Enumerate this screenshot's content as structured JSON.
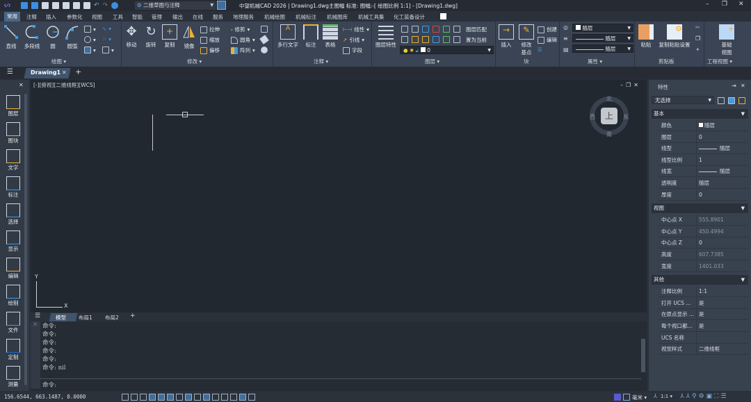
{
  "title": {
    "text": "中望机械CAD 2026 | Drawing1.dwg主图幅  标准: 图幅:-[ 绘图比例 1:1] - [Drawing1.dwg]",
    "workspace": "二维草图与注释"
  },
  "menu": [
    "常用",
    "注释",
    "插入",
    "参数化",
    "视图",
    "工具",
    "智能",
    "管理",
    "输出",
    "在线",
    "服务",
    "地理服务",
    "机械绘图",
    "机械标注",
    "机械图库",
    "机械工具集",
    "化工装备设计"
  ],
  "ribbon": {
    "draw": {
      "label": "绘图",
      "line": "直线",
      "polyline": "多段线",
      "circle": "圆",
      "arc": "圆弧"
    },
    "modify": {
      "label": "修改",
      "move": "移动",
      "rotate": "旋转",
      "copy": "复制",
      "mirror": "镜像",
      "stretch": "拉伸",
      "scale": "缩放",
      "offset": "偏移",
      "trim": "修剪",
      "fillet": "圆角",
      "array": "阵列"
    },
    "annotate": {
      "label": "注释",
      "mtext": "多行文字",
      "dim": "标注",
      "table": "表格",
      "linear": "线性",
      "leader": "引线",
      "field": "字段"
    },
    "layer": {
      "label": "图层",
      "props": "图层特性",
      "match": "图层匹配",
      "setcurrent": "置为当前",
      "current": "0"
    },
    "block": {
      "label": "块",
      "insert": "插入",
      "basepoint": "修改基点",
      "create": "创建",
      "edit": "编辑"
    },
    "properties": {
      "label": "属性",
      "color": "随层",
      "linetype": "随层",
      "lineweight": "随层"
    },
    "clipboard": {
      "label": "剪贴板",
      "paste": "粘贴",
      "pastesettings": "复制粘贴设置"
    },
    "drawingview": {
      "label": "工程视图",
      "base": "基础视图"
    }
  },
  "doc_tab": "Drawing1",
  "viewport_label": "[-][俯视][二维线框][WCS]",
  "viewcube": {
    "top": "上",
    "n": "北",
    "s": "南",
    "e": "东",
    "w": "西"
  },
  "ucs": {
    "x": "X",
    "y": "Y"
  },
  "palette": [
    "图层",
    "图块",
    "文字",
    "标注",
    "选择",
    "显示",
    "编辑",
    "绘制",
    "文件",
    "定制",
    "测量"
  ],
  "layout_tabs": [
    "模型",
    "布局1",
    "布局2"
  ],
  "command": {
    "history": [
      "命令:",
      "命令:",
      "命令:",
      "命令:",
      "命令:",
      "命令: nil"
    ],
    "prompt": "命令:"
  },
  "properties": {
    "title": "特性",
    "selection": "无选择",
    "sections": [
      {
        "name": "基本",
        "rows": [
          [
            "颜色",
            "随层"
          ],
          [
            "图层",
            "0"
          ],
          [
            "线型",
            "随层"
          ],
          [
            "线型比例",
            "1"
          ],
          [
            "线宽",
            "随层"
          ],
          [
            "透明度",
            "随层"
          ],
          [
            "厚度",
            "0"
          ]
        ]
      },
      {
        "name": "视图",
        "rows": [
          [
            "中心点 X",
            "555.8901"
          ],
          [
            "中心点 Y",
            "450.4994"
          ],
          [
            "中心点 Z",
            "0"
          ],
          [
            "高度",
            "607.7385"
          ],
          [
            "宽度",
            "1401.033"
          ]
        ]
      },
      {
        "name": "其他",
        "rows": [
          [
            "注释比例",
            "1:1"
          ],
          [
            "打开 UCS ...",
            "是"
          ],
          [
            "在原点显示 ...",
            "是"
          ],
          [
            "每个视口都...",
            "是"
          ],
          [
            "UCS 名称",
            ""
          ],
          [
            "视觉样式",
            "二维线框"
          ]
        ]
      }
    ]
  },
  "status": {
    "coords": "156.6544, 663.1487, 0.0000",
    "units": "毫米",
    "scale": "1:1"
  },
  "colors": {
    "accent": "#4a6685",
    "canvas": "#212830",
    "ribbon": "#3a4454"
  }
}
